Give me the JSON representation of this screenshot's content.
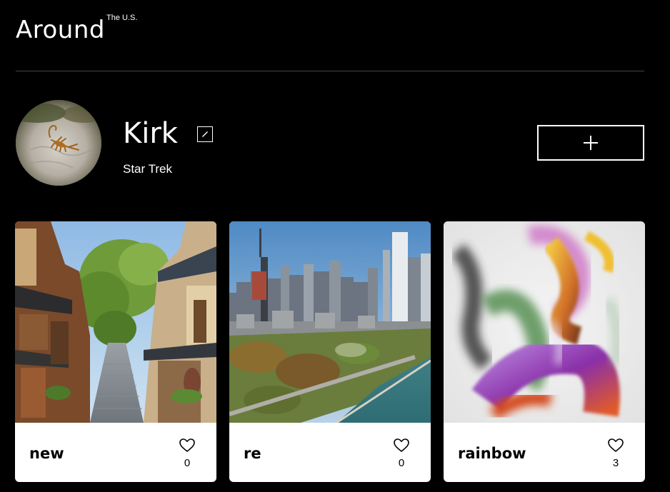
{
  "header": {
    "title": "Around",
    "subtitle": "The U.S."
  },
  "profile": {
    "name": "Kirk",
    "subtitle": "Star Trek",
    "avatar_icon": "scorpion-photo",
    "edit_icon": "edit-pencil-icon",
    "add_icon": "plus-icon"
  },
  "cards": [
    {
      "title": "new",
      "likes": "0",
      "image": "kyoto-street-photo",
      "like_icon": "heart-icon"
    },
    {
      "title": "re",
      "likes": "0",
      "image": "chicago-skyline-photo",
      "like_icon": "heart-icon"
    },
    {
      "title": "rainbow",
      "likes": "3",
      "image": "abstract-rainbow-swirl",
      "like_icon": "heart-icon"
    }
  ],
  "colors": {
    "background": "#000000",
    "card_background": "#ffffff",
    "text_primary": "#ffffff",
    "divider": "#444444"
  }
}
